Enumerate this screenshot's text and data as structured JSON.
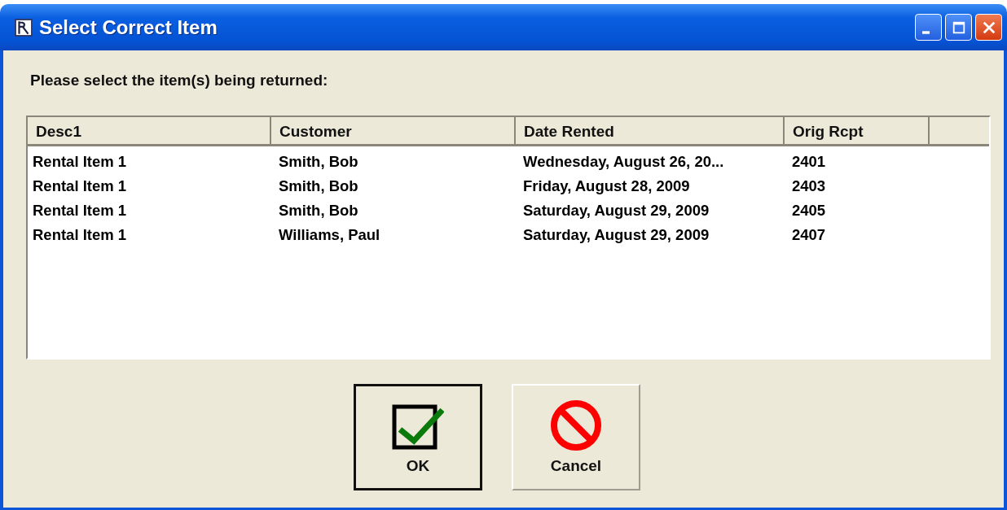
{
  "window": {
    "title": "Select Correct Item"
  },
  "prompt": "Please select the item(s) being returned:",
  "table": {
    "columns": [
      "Desc1",
      "Customer",
      "Date Rented",
      "Orig Rcpt"
    ],
    "rows": [
      {
        "cells": [
          "Rental Item 1",
          "Smith, Bob",
          "Wednesday, August 26, 20...",
          "2401"
        ],
        "selected": false
      },
      {
        "cells": [
          "Rental Item 1",
          "Smith, Bob",
          "Friday, August 28, 2009",
          "2403"
        ],
        "selected": false
      },
      {
        "cells": [
          "Rental Item 1",
          "Smith, Bob",
          "Saturday, August 29, 2009",
          "2405"
        ],
        "selected": false
      },
      {
        "cells": [
          "Rental Item 1",
          "Williams, Paul",
          "Saturday, August 29, 2009",
          "2407"
        ],
        "selected": false
      }
    ]
  },
  "buttons": [
    {
      "label": "OK",
      "kind": "ok",
      "default": true
    },
    {
      "label": "Cancel",
      "kind": "cancel",
      "default": false
    }
  ]
}
